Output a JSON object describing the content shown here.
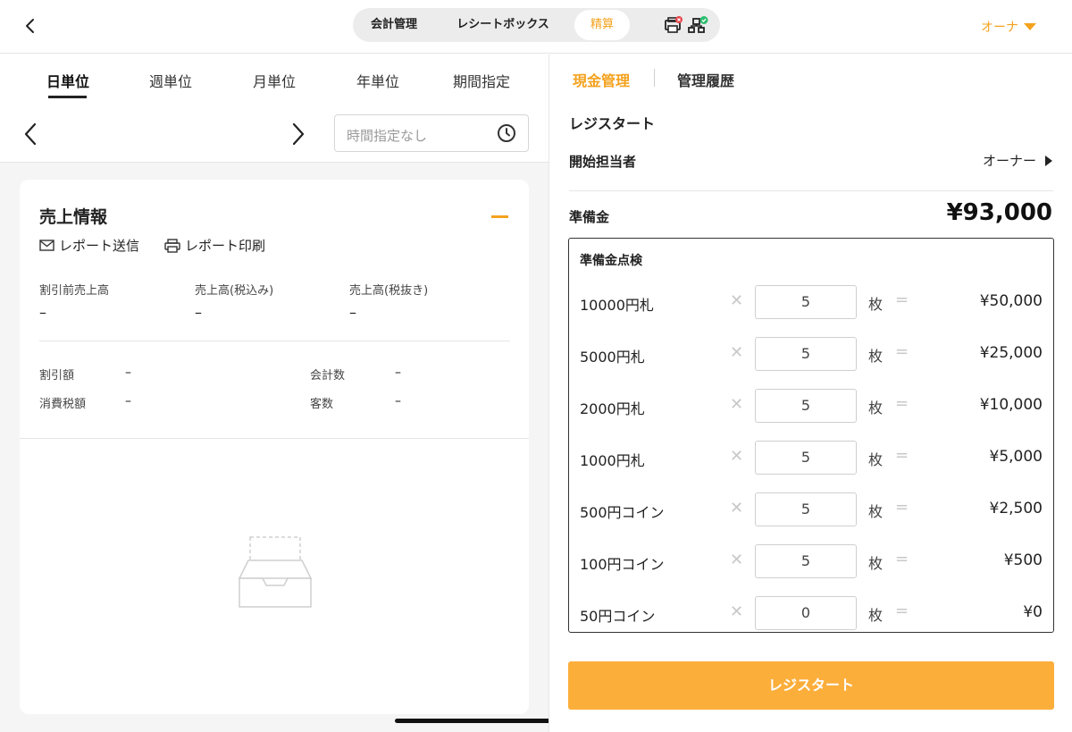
{
  "header": {
    "back_icon": "chevron-left-icon",
    "segments": [
      {
        "label": "会計管理"
      },
      {
        "label": "レシートボックス"
      },
      {
        "label": "精算",
        "active": true
      }
    ],
    "status_icons": [
      "printer-error-icon",
      "network-ok-icon"
    ],
    "owner_menu": {
      "label": "オーナ",
      "icon": "triangle-down-icon"
    },
    "accent_color": "#f4a21e"
  },
  "left": {
    "period_tabs": [
      {
        "label": "日単位",
        "active": true
      },
      {
        "label": "週単位"
      },
      {
        "label": "月単位"
      },
      {
        "label": "年単位"
      },
      {
        "label": "期間指定"
      }
    ],
    "time_filter": {
      "placeholder": "時間指定なし",
      "icon": "clock-icon"
    },
    "sales_card": {
      "title": "売上情報",
      "collapse_icon": "minus-icon",
      "actions": [
        {
          "label": "レポート送信",
          "icon": "mail-icon"
        },
        {
          "label": "レポート印刷",
          "icon": "printer-icon"
        }
      ],
      "main_metrics": [
        {
          "label": "割引前売上高",
          "value": "–"
        },
        {
          "label": "売上高(税込み)",
          "value": "–"
        },
        {
          "label": "売上高(税抜き)",
          "value": "–"
        }
      ],
      "sub_metrics": [
        {
          "label": "割引額",
          "value": "–"
        },
        {
          "label": "会計数",
          "value": "–"
        },
        {
          "label": "消費税額",
          "value": "–"
        },
        {
          "label": "客数",
          "value": "–"
        }
      ],
      "empty_icon": "empty-tray-icon"
    }
  },
  "right": {
    "tabs": [
      {
        "label": "現金管理",
        "active": true
      },
      {
        "label": "管理履歴"
      }
    ],
    "register_heading": "レジスタート",
    "starter": {
      "label": "開始担当者",
      "value": "オーナー"
    },
    "fund": {
      "label": "準備金",
      "value": "¥93,000"
    },
    "check": {
      "title": "準備金点検",
      "times_symbol": "✕",
      "equals_symbol": "=",
      "unit": "枚",
      "rows": [
        {
          "name": "10000円札",
          "qty": "5",
          "amount": "¥50,000"
        },
        {
          "name": "5000円札",
          "qty": "5",
          "amount": "¥25,000"
        },
        {
          "name": "2000円札",
          "qty": "5",
          "amount": "¥10,000"
        },
        {
          "name": "1000円札",
          "qty": "5",
          "amount": "¥5,000"
        },
        {
          "name": "500円コイン",
          "qty": "5",
          "amount": "¥2,500"
        },
        {
          "name": "100円コイン",
          "qty": "5",
          "amount": "¥500"
        },
        {
          "name": "50円コイン",
          "qty": "0",
          "amount": "¥0"
        }
      ]
    },
    "start_button": "レジスタート"
  }
}
